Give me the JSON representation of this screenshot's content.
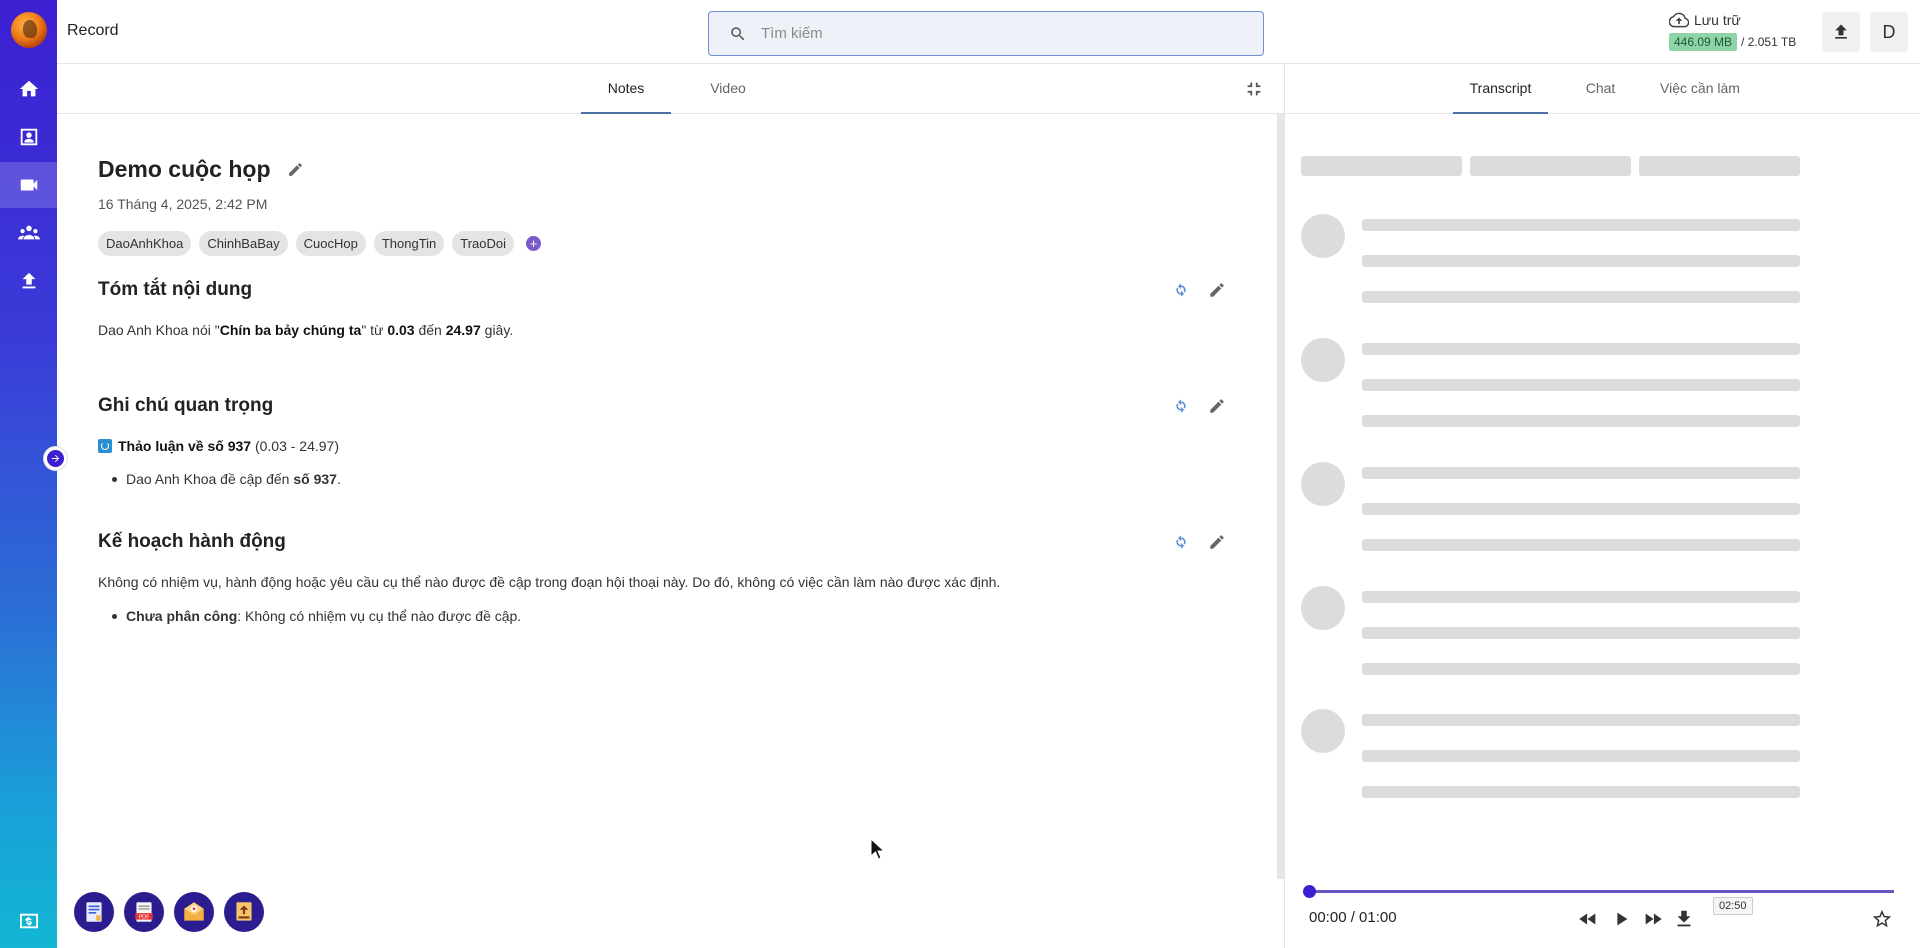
{
  "app": {
    "title": "Record"
  },
  "search": {
    "placeholder": "Tìm kiếm"
  },
  "storage": {
    "label": "Lưu trữ",
    "used": "446.09 MB",
    "total": "/ 2.051 TB"
  },
  "user": {
    "initial": "D"
  },
  "left_tabs": [
    {
      "label": "Notes"
    },
    {
      "label": "Video"
    }
  ],
  "right_tabs": [
    {
      "label": "Transcript"
    },
    {
      "label": "Chat"
    },
    {
      "label": "Việc cần làm"
    }
  ],
  "note": {
    "title": "Demo cuộc họp",
    "date": "16 Tháng 4, 2025, 2:42 PM",
    "tags": [
      "DaoAnhKhoa",
      "ChinhBaBay",
      "CuocHop",
      "ThongTin",
      "TraoDoi"
    ],
    "add_tag": "+"
  },
  "summary": {
    "heading": "Tóm tắt nội dung",
    "p_prefix": "Dao Anh Khoa nói \"",
    "p_quote": "Chín ba bảy chúng ta",
    "p_mid": "\" từ ",
    "p_start": "0.03",
    "p_mid2": " đến ",
    "p_end": "24.97",
    "p_suffix": " giây."
  },
  "notes_section": {
    "heading": "Ghi chú quan trọng",
    "topic_title": "Thảo luận về số 937",
    "topic_range": " (0.03 - 24.97)",
    "bullet_prefix": "Dao Anh Khoa đề cập đến ",
    "bullet_bold": "số 937",
    "bullet_suffix": "."
  },
  "action_section": {
    "heading": "Kế hoạch hành động",
    "paragraph": "Không có nhiệm vụ, hành động hoặc yêu cầu cụ thể nào được đề cập trong đoạn hội thoại này. Do đó, không có việc cần làm nào được xác định.",
    "bullet_bold": "Chưa phân công",
    "bullet_rest": ": Không có nhiệm vụ cụ thể nào được đề cập."
  },
  "player": {
    "time": "00:00 / 01:00",
    "tooltip": "02:50"
  },
  "colors": {
    "accent": "#3b1fd1",
    "storage_badge": "#8fd3a8",
    "tab_underline": "#4a6fa5"
  },
  "icons": [
    "home-icon",
    "contacts-icon",
    "video-icon",
    "group-icon",
    "upload-icon",
    "search-icon",
    "cloud-icon",
    "edit-icon",
    "refresh-icon",
    "collapse-icon",
    "rewind-icon",
    "play-icon",
    "fast-forward-icon",
    "download-icon",
    "star-icon"
  ]
}
